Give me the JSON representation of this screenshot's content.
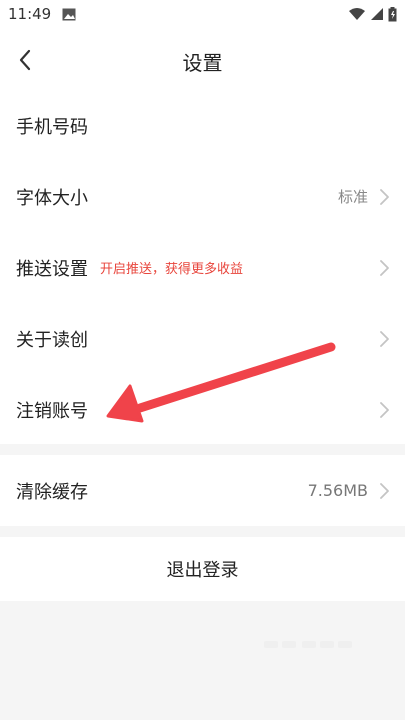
{
  "status": {
    "time": "11:49"
  },
  "nav": {
    "title": "设置"
  },
  "settings": {
    "items": [
      {
        "label": "手机号码",
        "value": "",
        "note": "",
        "chevron": false
      },
      {
        "label": "字体大小",
        "value": "标准",
        "note": "",
        "chevron": true
      },
      {
        "label": "推送设置",
        "value": "",
        "note": "开启推送，获得更多收益",
        "chevron": true
      },
      {
        "label": "关于读创",
        "value": "",
        "note": "",
        "chevron": true
      },
      {
        "label": "注销账号",
        "value": "",
        "note": "",
        "chevron": true
      }
    ],
    "cache": {
      "label": "清除缓存",
      "value": "7.56MB"
    }
  },
  "logout": {
    "label": "退出登录"
  },
  "colors": {
    "accent_red": "#e8453c",
    "arrow_red": "#f0434a",
    "background": "#f5f5f5"
  }
}
